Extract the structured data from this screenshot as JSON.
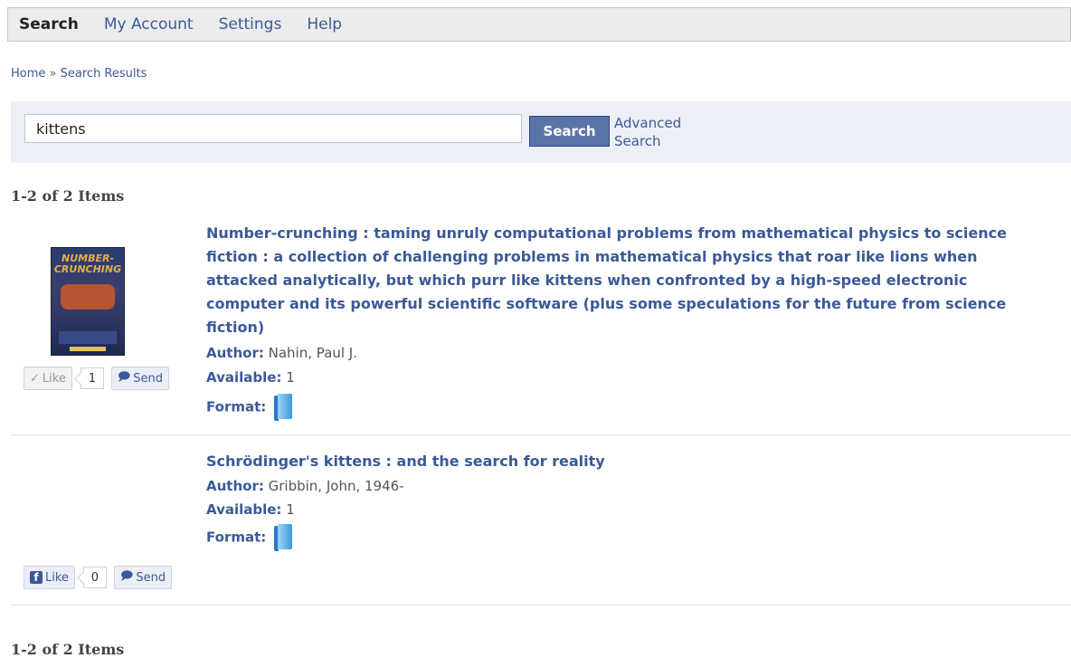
{
  "nav": {
    "items": [
      {
        "label": "Search"
      },
      {
        "label": "My Account"
      },
      {
        "label": "Settings"
      },
      {
        "label": "Help"
      }
    ]
  },
  "breadcrumb": {
    "home": "Home",
    "separator": "»",
    "current": "Search Results"
  },
  "search": {
    "query": "kittens",
    "button": "Search",
    "advanced_line1": "Advanced",
    "advanced_line2": "Search"
  },
  "counts": {
    "top": "1-2 of 2 Items",
    "bottom": "1-2 of 2 Items"
  },
  "results": [
    {
      "title": "Number-crunching : taming unruly computational problems from mathematical physics to science fiction : a collection of challenging problems in mathematical physics that roar like lions when attacked analytically, but which purr like kittens when confronted by a high-speed electronic computer and its powerful scientific software (plus some speculations for the future from science fiction)",
      "author_label": "Author:",
      "author": "Nahin, Paul J.",
      "available_label": "Available:",
      "available": "1",
      "format_label": "Format:",
      "format_icon": "book-icon",
      "cover_text": "NUMBER-CRUNCHING",
      "like": "Like",
      "like_count": "1",
      "send": "Send",
      "like_state": "liked"
    },
    {
      "title": "Schrödinger's kittens : and the search for reality",
      "author_label": "Author:",
      "author": "Gribbin, John, 1946-",
      "available_label": "Available:",
      "available": "1",
      "format_label": "Format:",
      "format_icon": "book-icon",
      "like": "Like",
      "like_count": "0",
      "send": "Send",
      "like_state": "not-liked"
    }
  ],
  "colors": {
    "link": "#3b5998",
    "search_button": "#5b74a8",
    "search_bar_bg": "#eceff5",
    "nav_bg": "#ececec"
  }
}
